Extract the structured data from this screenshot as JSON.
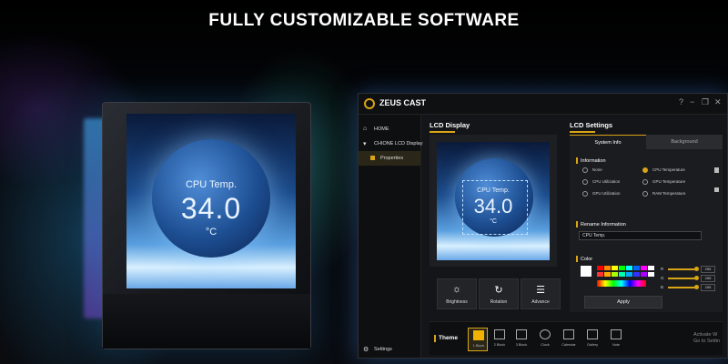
{
  "headline": "FULLY CUSTOMIZABLE SOFTWARE",
  "hardware_display": {
    "label": "CPU Temp.",
    "value": "34.0",
    "unit": "°C"
  },
  "app": {
    "title": "ZEUS CAST",
    "window_controls": [
      "?",
      "−",
      "❐",
      "✕"
    ],
    "sidebar": {
      "items": [
        {
          "label": "HOME",
          "icon": "home-icon"
        },
        {
          "label": "CHIONE LCD Display",
          "icon": "chevron-down-icon"
        },
        {
          "label": "Properties",
          "icon": "square-icon"
        }
      ],
      "settings_label": "Settings"
    },
    "lcd_display": {
      "title": "LCD Display",
      "preview": {
        "label": "CPU Temp.",
        "value": "34.0",
        "unit": "°C"
      },
      "buttons": [
        {
          "label": "Brightness",
          "icon": "sun-icon"
        },
        {
          "label": "Rotation",
          "icon": "rotate-icon"
        },
        {
          "label": "Advance",
          "icon": "sliders-icon"
        }
      ]
    },
    "lcd_settings": {
      "title": "LCD Settings",
      "tabs": [
        "System Info",
        "Background"
      ],
      "information_title": "Information",
      "options": [
        {
          "label": "None",
          "selected": false
        },
        {
          "label": "CPU Temperature",
          "selected": true
        },
        {
          "label": "CPU Utilization",
          "selected": false
        },
        {
          "label": "GPU Temperature",
          "selected": false
        },
        {
          "label": "GPU Utilization",
          "selected": false
        },
        {
          "label": "RAM Temperature",
          "selected": false
        }
      ],
      "rename_title": "Rename Information",
      "rename_value": "CPU Temp.",
      "color_title": "Color",
      "rgb": [
        {
          "channel": "R",
          "value": "255"
        },
        {
          "channel": "G",
          "value": "255"
        },
        {
          "channel": "B",
          "value": "255"
        }
      ],
      "palette": [
        "#ff0000",
        "#ff8800",
        "#ffff00",
        "#00ff00",
        "#00ffff",
        "#0066ff",
        "#ff00ff",
        "#ffffff",
        "#ff3333",
        "#ffaa00",
        "#aaff00",
        "#00ffaa",
        "#00aaff",
        "#3333ff",
        "#aa00ff",
        "#ffffff"
      ],
      "apply_label": "Apply"
    },
    "theme": {
      "title": "Theme",
      "items": [
        {
          "label": "1 Block",
          "icon": "block-icon",
          "active": true
        },
        {
          "label": "2 Block",
          "icon": "two-block-icon",
          "active": false
        },
        {
          "label": "3 Block",
          "icon": "three-block-icon",
          "active": false
        },
        {
          "label": "Clock",
          "icon": "clock-icon",
          "active": false
        },
        {
          "label": "Calendar",
          "icon": "calendar-icon",
          "active": false
        },
        {
          "label": "Gallery",
          "icon": "gallery-icon",
          "active": false
        },
        {
          "label": "Note",
          "icon": "note-icon",
          "active": false
        }
      ]
    },
    "watermark": [
      "Activate W",
      "Go to Settin"
    ]
  }
}
